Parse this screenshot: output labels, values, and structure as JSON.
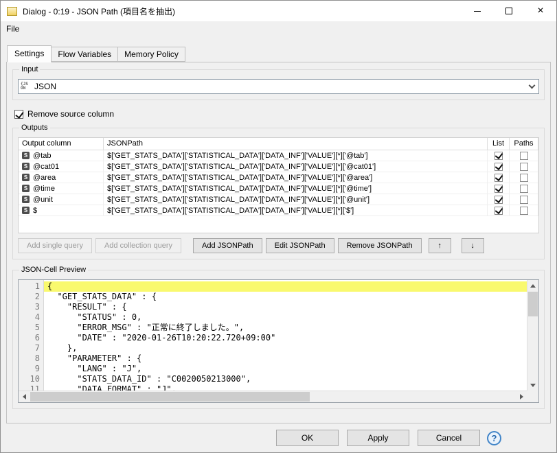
{
  "colors": {
    "titlebar_bg": "#ffffff",
    "highlight_yellow": "#f9f96e",
    "help_blue": "#2a6bb0"
  },
  "window": {
    "title": "Dialog - 0:19 - JSON Path (項目名を抽出)",
    "close_glyph": "×"
  },
  "menu": {
    "file": "File"
  },
  "tabs": [
    {
      "label": "Settings"
    },
    {
      "label": "Flow Variables"
    },
    {
      "label": "Memory Policy"
    }
  ],
  "input": {
    "group_label": "Input",
    "selected_value": "JSON",
    "icon_line1": "{JS",
    "icon_line2": "ON"
  },
  "remove_source_column": {
    "label": "Remove source column",
    "checked": true
  },
  "outputs": {
    "group_label": "Outputs",
    "headers": {
      "output_column": "Output column",
      "jsonpath": "JSONPath",
      "list": "List",
      "paths": "Paths"
    },
    "rows": [
      {
        "type": "S",
        "column": "@tab",
        "path": "$['GET_STATS_DATA']['STATISTICAL_DATA']['DATA_INF']['VALUE'][*]['@tab']",
        "list": true,
        "paths": false
      },
      {
        "type": "S",
        "column": "@cat01",
        "path": "$['GET_STATS_DATA']['STATISTICAL_DATA']['DATA_INF']['VALUE'][*]['@cat01']",
        "list": true,
        "paths": false
      },
      {
        "type": "S",
        "column": "@area",
        "path": "$['GET_STATS_DATA']['STATISTICAL_DATA']['DATA_INF']['VALUE'][*]['@area']",
        "list": true,
        "paths": false
      },
      {
        "type": "S",
        "column": "@time",
        "path": "$['GET_STATS_DATA']['STATISTICAL_DATA']['DATA_INF']['VALUE'][*]['@time']",
        "list": true,
        "paths": false
      },
      {
        "type": "S",
        "column": "@unit",
        "path": "$['GET_STATS_DATA']['STATISTICAL_DATA']['DATA_INF']['VALUE'][*]['@unit']",
        "list": true,
        "paths": false
      },
      {
        "type": "S",
        "column": "$",
        "path": "$['GET_STATS_DATA']['STATISTICAL_DATA']['DATA_INF']['VALUE'][*]['$']",
        "list": true,
        "paths": false
      }
    ],
    "buttons": {
      "add_single": {
        "label": "Add single query",
        "enabled": false
      },
      "add_collection": {
        "label": "Add collection query",
        "enabled": false
      },
      "add_jsonpath": {
        "label": "Add JSONPath",
        "enabled": true
      },
      "edit_jsonpath": {
        "label": "Edit JSONPath",
        "enabled": true
      },
      "remove_jsonpath": {
        "label": "Remove JSONPath",
        "enabled": true
      },
      "move_up": {
        "label": "↑",
        "enabled": true
      },
      "move_down": {
        "label": "↓",
        "enabled": true
      }
    }
  },
  "preview": {
    "group_label": "JSON-Cell Preview",
    "highlighted_line": 1,
    "lines": [
      {
        "num": 1,
        "text": "{"
      },
      {
        "num": 2,
        "text": "  \"GET_STATS_DATA\" : {"
      },
      {
        "num": 3,
        "text": "    \"RESULT\" : {"
      },
      {
        "num": 4,
        "text": "      \"STATUS\" : 0,"
      },
      {
        "num": 5,
        "text": "      \"ERROR_MSG\" : \"正常に終了しました。\","
      },
      {
        "num": 6,
        "text": "      \"DATE\" : \"2020-01-26T10:20:22.720+09:00\""
      },
      {
        "num": 7,
        "text": "    },"
      },
      {
        "num": 8,
        "text": "    \"PARAMETER\" : {"
      },
      {
        "num": 9,
        "text": "      \"LANG\" : \"J\","
      },
      {
        "num": 10,
        "text": "      \"STATS_DATA_ID\" : \"C0020050213000\","
      },
      {
        "num": 11,
        "text": "      \"DATA_FORMAT\" : \"J\","
      }
    ]
  },
  "footer": {
    "ok": "OK",
    "apply": "Apply",
    "cancel": "Cancel",
    "help": "?"
  }
}
